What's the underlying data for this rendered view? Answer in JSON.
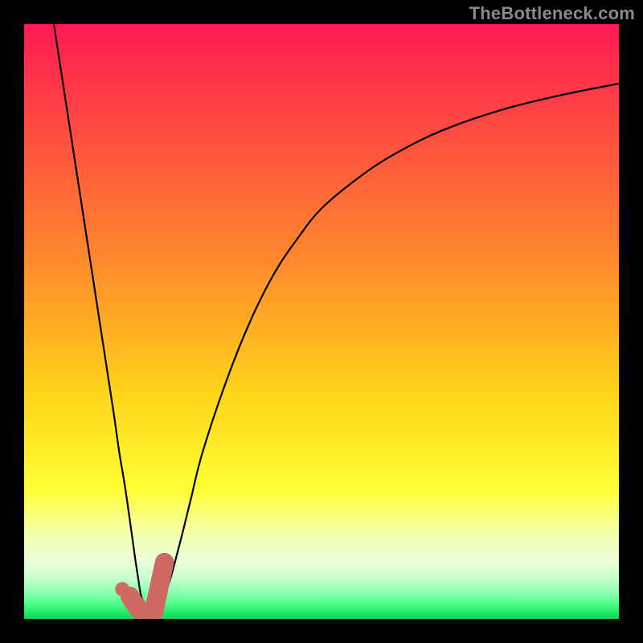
{
  "watermark": "TheBottleneck.com",
  "colors": {
    "frame": "#000000",
    "curve": "#000000",
    "checkmark_fill": "#cf6a63",
    "gradient_stops": [
      {
        "offset": 0.0,
        "color": "#ff1a52"
      },
      {
        "offset": 0.4,
        "color": "#ff8a2c"
      },
      {
        "offset": 0.62,
        "color": "#ffd31a"
      },
      {
        "offset": 0.78,
        "color": "#ffff33"
      },
      {
        "offset": 0.86,
        "color": "#f3ffb0"
      },
      {
        "offset": 0.905,
        "color": "#eaffd9"
      },
      {
        "offset": 0.93,
        "color": "#c9ffd0"
      },
      {
        "offset": 0.955,
        "color": "#8dffae"
      },
      {
        "offset": 0.975,
        "color": "#4cff87"
      },
      {
        "offset": 0.99,
        "color": "#1fe866"
      },
      {
        "offset": 1.0,
        "color": "#0fd85c"
      }
    ]
  },
  "chart_data": {
    "type": "line",
    "title": "",
    "xlabel": "",
    "ylabel": "",
    "xlim": [
      0,
      100
    ],
    "ylim": [
      0,
      100
    ],
    "grid": false,
    "series": [
      {
        "name": "bottleneck-curve",
        "x": [
          5,
          7,
          9,
          11,
          13,
          15,
          16,
          17,
          18,
          19,
          20,
          22,
          24,
          26,
          28,
          30,
          34,
          38,
          42,
          46,
          50,
          56,
          62,
          70,
          80,
          90,
          100
        ],
        "y": [
          100,
          87,
          74,
          61,
          48,
          35,
          28,
          22,
          15,
          8,
          3,
          2,
          5,
          12,
          20,
          28,
          40,
          50,
          58,
          64,
          69,
          74,
          78,
          82,
          85.5,
          88,
          90
        ]
      }
    ],
    "annotations": [
      {
        "name": "checkmark-dot",
        "shape": "circle",
        "cx": 16.5,
        "cy": 5,
        "r": 1.2,
        "color": "#cf6a63"
      },
      {
        "name": "checkmark-hook",
        "shape": "path",
        "points": [
          {
            "x": 17.8,
            "y": 3.8
          },
          {
            "x": 19.3,
            "y": 1.2
          },
          {
            "x": 21.8,
            "y": 1.2
          },
          {
            "x": 23.6,
            "y": 9.5
          }
        ],
        "stroke_width": 3.2,
        "color": "#cf6a63"
      }
    ]
  }
}
